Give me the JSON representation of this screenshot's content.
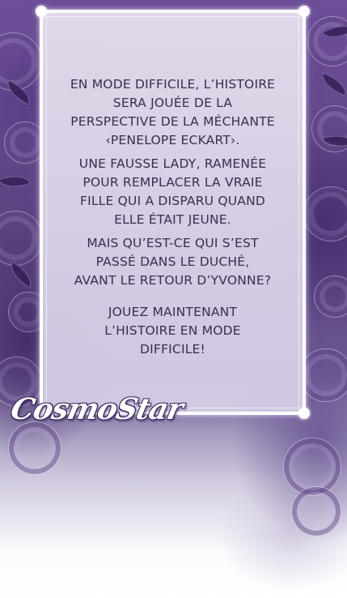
{
  "panel": {
    "paragraphs": [
      "EN MODE DIFFICILE, L’HISTOIRE\nSERA JOUÉE DE LA\nPERSPECTIVE DE LA MÉCHANTE\n‹PENELOPE ECKART›.",
      "UNE FAUSSE LADY, RAMENÉE\nPOUR REMPLACER LA VRAIE\nFILLE QUI A DISPARU QUAND\nELLE ÉTAIT JEUNE.",
      "MAIS QU’EST-CE QUI S’EST\nPASSÉ DANS LE DUCHÉ,\nAVANT LE RETOUR D’YVONNE?",
      "JOUEZ MAINTENANT\nL’HISTOIRE EN MODE\nDIFFICILE!"
    ]
  },
  "watermark": {
    "text": "CosmoStar"
  },
  "colors": {
    "text": "#3b2d4f",
    "panel_border": "#ffffff",
    "rose_dark": "#4a2f7a",
    "background_bottom": "#ffffff"
  }
}
